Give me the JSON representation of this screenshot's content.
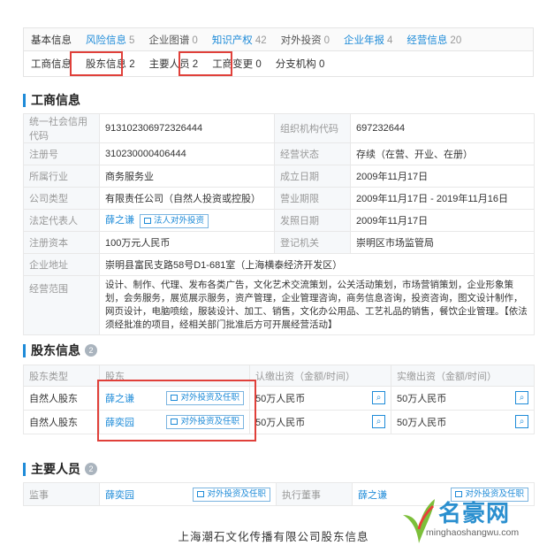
{
  "tabs_top": [
    {
      "label": "基本信息",
      "count": ""
    },
    {
      "label": "风险信息",
      "count": "5"
    },
    {
      "label": "企业图谱",
      "count": "0"
    },
    {
      "label": "知识产权",
      "count": "42"
    },
    {
      "label": "对外投资",
      "count": "0"
    },
    {
      "label": "企业年报",
      "count": "4"
    },
    {
      "label": "经营信息",
      "count": "20"
    }
  ],
  "tabs_sub": [
    {
      "label": "工商信息"
    },
    {
      "label": "股东信息 2"
    },
    {
      "label": "主要人员 2"
    },
    {
      "label": "工商变更 0"
    },
    {
      "label": "分支机构 0"
    }
  ],
  "business": {
    "title": "工商信息",
    "rows": [
      {
        "k1": "统一社会信用代码",
        "v1": "913102306972326444",
        "k2": "组织机构代码",
        "v2": "697232644"
      },
      {
        "k1": "注册号",
        "v1": "310230000406444",
        "k2": "经营状态",
        "v2": "存续（在营、开业、在册）"
      },
      {
        "k1": "所属行业",
        "v1": "商务服务业",
        "k2": "成立日期",
        "v2": "2009年11月17日"
      },
      {
        "k1": "公司类型",
        "v1": "有限责任公司（自然人投资或控股）",
        "k2": "营业期限",
        "v2": "2009年11月17日 - 2019年11月16日"
      },
      {
        "k1": "法定代表人",
        "v1": "薛之谦",
        "k2": "发照日期",
        "v2": "2009年11月17日"
      },
      {
        "k1": "注册资本",
        "v1": "100万元人民币",
        "k2": "登记机关",
        "v2": "崇明区市场监管局"
      }
    ],
    "legal_tag": "法人对外投资",
    "address_label": "企业地址",
    "address": "崇明县富民支路58号D1-681室（上海横泰经济开发区）",
    "scope_label": "经营范围",
    "scope": "设计、制作、代理、发布各类广告，文化艺术交流策划，公关活动策划，市场营销策划，企业形象策划，会务服务，展览展示服务，资产管理，企业管理咨询，商务信息咨询，投资咨询，图文设计制作，网页设计，电脑喷绘，服装设计、加工、销售，文化办公用品、工艺礼品的销售，餐饮企业管理。【依法须经批准的项目，经相关部门批准后方可开展经营活动】"
  },
  "shareholders": {
    "title": "股东信息",
    "badge": "2",
    "headers": [
      "股东类型",
      "股东",
      "认缴出资（金额/时间）",
      "实缴出资（金额/时间）"
    ],
    "rows": [
      {
        "type": "自然人股东",
        "name": "薛之谦",
        "tag": "对外投资及任职",
        "subscribed": "50万人民币",
        "paid": "50万人民币"
      },
      {
        "type": "自然人股东",
        "name": "薛奕园",
        "tag": "对外投资及任职",
        "subscribed": "50万人民币",
        "paid": "50万人民币"
      }
    ]
  },
  "personnel": {
    "title": "主要人员",
    "badge": "2",
    "rows": [
      {
        "role": "监事",
        "name": "薛奕园",
        "tag": "对外投资及任职",
        "role2": "执行董事",
        "name2": "薛之谦",
        "tag2": "对外投资及任职"
      }
    ]
  },
  "caption": "上海潮石文化传播有限公司股东信息",
  "watermark": {
    "brand": "名豪网",
    "url": "minghaoshangwu.com"
  },
  "colors": {
    "accent": "#1e8bd8",
    "highlight": "#e0403a"
  }
}
